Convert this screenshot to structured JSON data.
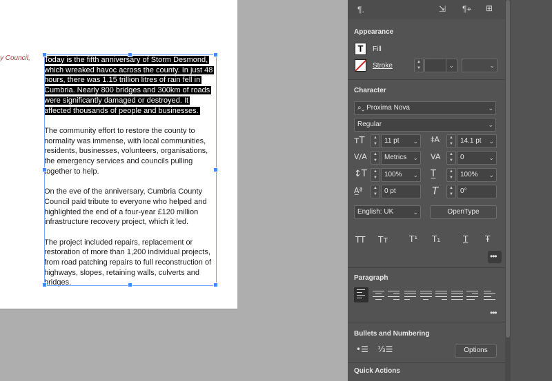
{
  "document": {
    "previous_frame_text": "y Council,",
    "paragraphs": [
      "Today is the fifth anniversary of Storm Desmond, which wreaked havoc across the county. In just 48 hours, there was 1.15 trillion litres of rain fell in Cumbria. Nearly 800 bridges and 300km of roads were significantly damaged or destroyed. It affected thousands of people and businesses.",
      "The community effort to restore the county to normality was immense, with local communities, residents, businesses, volunteers, organisations, the emergency services and councils pulling together to help.",
      "On the eve of the anniversary, Cumbria County Council paid tribute to everyone who helped and highlighted the end of a four-year £120 million infrastructure recovery project, which it led.",
      "The project included repairs, replacement or restoration of more than 1,200 individual projects, from road patching repairs to full reconstruction of highways, slopes, retaining walls, culverts and bridges."
    ]
  },
  "panel": {
    "appearance": {
      "title": "Appearance",
      "fill_label": "Fill",
      "stroke_label": "Stroke",
      "stroke_weight": ""
    },
    "character": {
      "title": "Character",
      "font_family": "Proxima Nova",
      "font_style": "Regular",
      "font_size": "11 pt",
      "leading": "14.1 pt",
      "kerning": "Metrics",
      "tracking": "0",
      "vertical_scale": "100%",
      "horizontal_scale": "100%",
      "baseline_shift": "0 pt",
      "skew": "0°",
      "language": "English: UK",
      "opentype_button": "OpenType",
      "case_buttons": [
        "TT",
        "Tт",
        "T¹",
        "T₁",
        "T",
        "Ŧ"
      ]
    },
    "paragraph": {
      "title": "Paragraph"
    },
    "bullets": {
      "title": "Bullets and Numbering",
      "options_button": "Options"
    },
    "quick_actions": {
      "title": "Quick Actions"
    },
    "more_glyph": "•••"
  },
  "colors": {
    "selection_bg": "#000000",
    "frame_blue": "#3d8bff",
    "panel_bg": "#535353",
    "pasteboard": "#aeaeae"
  }
}
